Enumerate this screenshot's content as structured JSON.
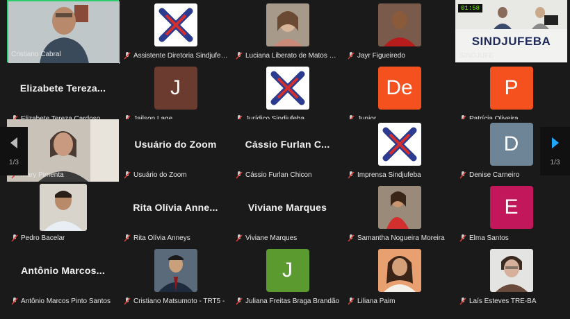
{
  "pagination": {
    "left": "1/3",
    "right": "1/3"
  },
  "conference_room": {
    "timer": "01:58",
    "banner": "SINDJUFEBA"
  },
  "participants": [
    {
      "name": "Cristiano Cabral",
      "type": "photo",
      "active": true
    },
    {
      "name": "Assistente Diretoria Sindjufeba",
      "type": "logo"
    },
    {
      "name": "Luciana Liberato de Matos Reis",
      "type": "photo"
    },
    {
      "name": "Jayr Figueiredo",
      "type": "photo"
    },
    {
      "name": "SINDJUFE",
      "type": "room"
    },
    {
      "name": "Elizabete Tereza Cardoso",
      "type": "text",
      "display": "Elizabete  Tereza..."
    },
    {
      "name": "Jailson Lage",
      "type": "letter",
      "letter": "J",
      "color": "#6b3b2f"
    },
    {
      "name": "Jurídico Sindjufeba",
      "type": "logo"
    },
    {
      "name": "Junior",
      "type": "letter",
      "letter": "De",
      "color": "#f4511e"
    },
    {
      "name": "Patrícia Oliveira",
      "type": "letter",
      "letter": "P",
      "color": "#f4511e"
    },
    {
      "name": "Mary Pimenta",
      "type": "photo"
    },
    {
      "name": "Usuário do Zoom",
      "type": "text",
      "display": "Usuário do Zoom"
    },
    {
      "name": "Cássio Furlan Chicon",
      "type": "text",
      "display": "Cássio  Furlan  C..."
    },
    {
      "name": "Imprensa Sindjufeba",
      "type": "logo"
    },
    {
      "name": "Denise Carneiro",
      "type": "letter",
      "letter": "D",
      "color": "#6e8597"
    },
    {
      "name": "Pedro Bacelar",
      "type": "photo"
    },
    {
      "name": "Rita Olívia Anneys",
      "type": "text",
      "display": "Rita  Olívia  Anne..."
    },
    {
      "name": "Viviane Marques",
      "type": "text",
      "display": "Viviane Marques"
    },
    {
      "name": "Samantha Nogueira Moreira",
      "type": "photo"
    },
    {
      "name": "Elma Santos",
      "type": "letter",
      "letter": "E",
      "color": "#c2185b"
    },
    {
      "name": "Antônio Marcos Pinto Santos",
      "type": "text",
      "display": "Antônio  Marcos..."
    },
    {
      "name": "Cristiano Matsumoto - TRT5 -",
      "type": "photo"
    },
    {
      "name": "Juliana Freitas Braga Brandão",
      "type": "letter",
      "letter": "J",
      "color": "#5b9a2f"
    },
    {
      "name": "Liliana Paim",
      "type": "photo"
    },
    {
      "name": "Laís Esteves TRE-BA",
      "type": "photo"
    }
  ]
}
